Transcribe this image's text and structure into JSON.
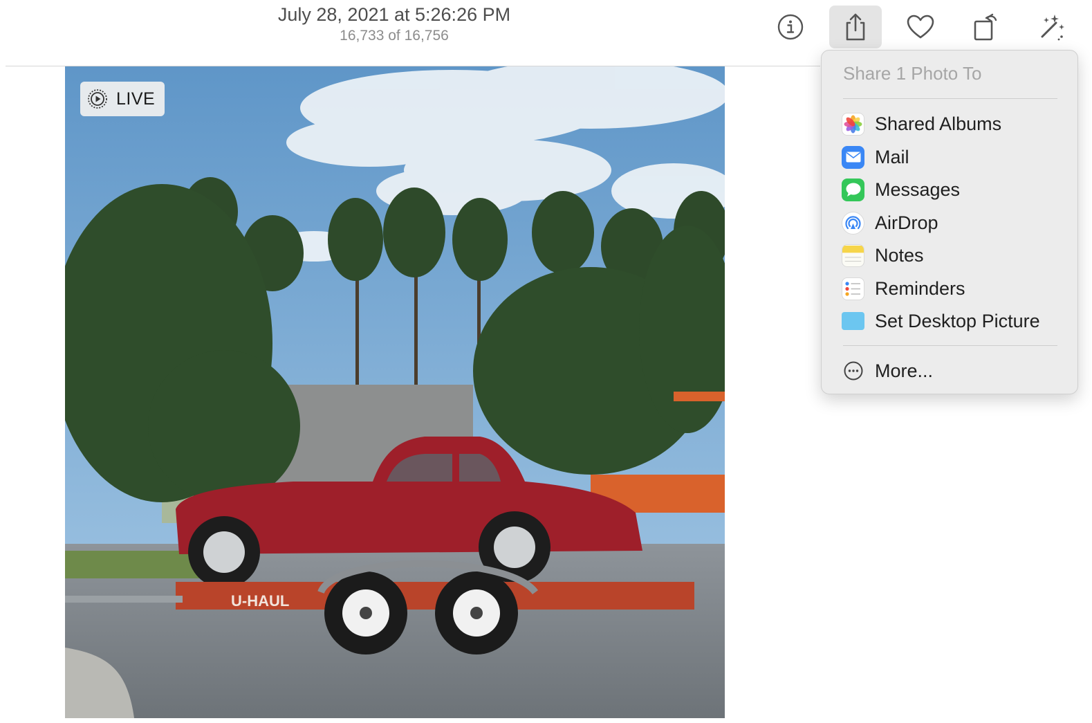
{
  "window": {
    "date_title": "July 28, 2021 at 5:26:26 PM",
    "photo_count": "16,733 of 16,756"
  },
  "toolbar": {
    "buttons": [
      {
        "name": "info",
        "icon": "info-icon"
      },
      {
        "name": "share",
        "icon": "share-icon",
        "active": true
      },
      {
        "name": "favorite",
        "icon": "heart-icon"
      },
      {
        "name": "rotate",
        "icon": "rotate-icon"
      },
      {
        "name": "enhance",
        "icon": "magic-wand-icon"
      }
    ]
  },
  "photo": {
    "live_label": "LIVE",
    "trailer_text": "U-HAUL"
  },
  "share_menu": {
    "header": "Share 1 Photo To",
    "items": [
      {
        "label": "Shared Albums",
        "icon": "photos-app-icon"
      },
      {
        "label": "Mail",
        "icon": "mail-app-icon"
      },
      {
        "label": "Messages",
        "icon": "messages-app-icon"
      },
      {
        "label": "AirDrop",
        "icon": "airdrop-icon"
      },
      {
        "label": "Notes",
        "icon": "notes-app-icon"
      },
      {
        "label": "Reminders",
        "icon": "reminders-app-icon"
      },
      {
        "label": "Set Desktop Picture",
        "icon": "desktop-picture-icon"
      }
    ],
    "more_label": "More...",
    "more_icon": "more-ellipsis-icon"
  },
  "colors": {
    "mail_blue": "#3a87f5",
    "messages_green": "#34c759",
    "notes_yellow": "#f6d54a",
    "desktop_cyan": "#6cc6f0"
  }
}
